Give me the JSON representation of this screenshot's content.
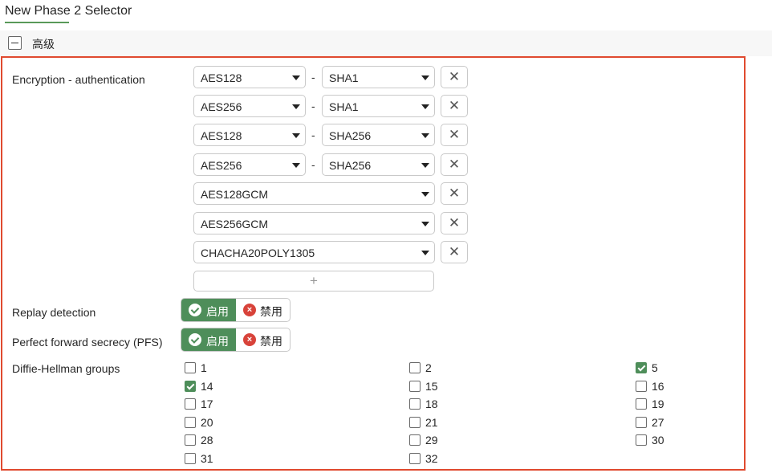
{
  "page": {
    "title": "New Phase 2 Selector"
  },
  "section": {
    "label": "高级"
  },
  "encryption": {
    "label": "Encryption - authentication",
    "dash": "-",
    "remove_glyph": "✕",
    "add_glyph": "+",
    "pairs": [
      {
        "enc": "AES128",
        "auth": "SHA1"
      },
      {
        "enc": "AES256",
        "auth": "SHA1"
      },
      {
        "enc": "AES128",
        "auth": "SHA256"
      },
      {
        "enc": "AES256",
        "auth": "SHA256"
      },
      {
        "enc": "AES128GCM"
      },
      {
        "enc": "AES256GCM"
      },
      {
        "enc": "CHACHA20POLY1305"
      }
    ]
  },
  "replay": {
    "label": "Replay detection",
    "on_label": "启用",
    "off_label": "禁用",
    "selected": "on"
  },
  "pfs": {
    "label": "Perfect forward secrecy (PFS)",
    "on_label": "启用",
    "off_label": "禁用",
    "selected": "on"
  },
  "dh": {
    "label": "Diffie-Hellman groups",
    "groups": [
      {
        "label": "1",
        "checked": false
      },
      {
        "label": "2",
        "checked": false
      },
      {
        "label": "5",
        "checked": true
      },
      {
        "label": "14",
        "checked": true
      },
      {
        "label": "15",
        "checked": false
      },
      {
        "label": "16",
        "checked": false
      },
      {
        "label": "17",
        "checked": false
      },
      {
        "label": "18",
        "checked": false
      },
      {
        "label": "19",
        "checked": false
      },
      {
        "label": "20",
        "checked": false
      },
      {
        "label": "21",
        "checked": false
      },
      {
        "label": "27",
        "checked": false
      },
      {
        "label": "28",
        "checked": false
      },
      {
        "label": "29",
        "checked": false
      },
      {
        "label": "30",
        "checked": false
      },
      {
        "label": "31",
        "checked": false
      },
      {
        "label": "32",
        "checked": false
      }
    ]
  },
  "colors": {
    "accent_green": "#4e8e5a",
    "highlight_border": "#e04a2f",
    "disable_red": "#d8433a"
  }
}
